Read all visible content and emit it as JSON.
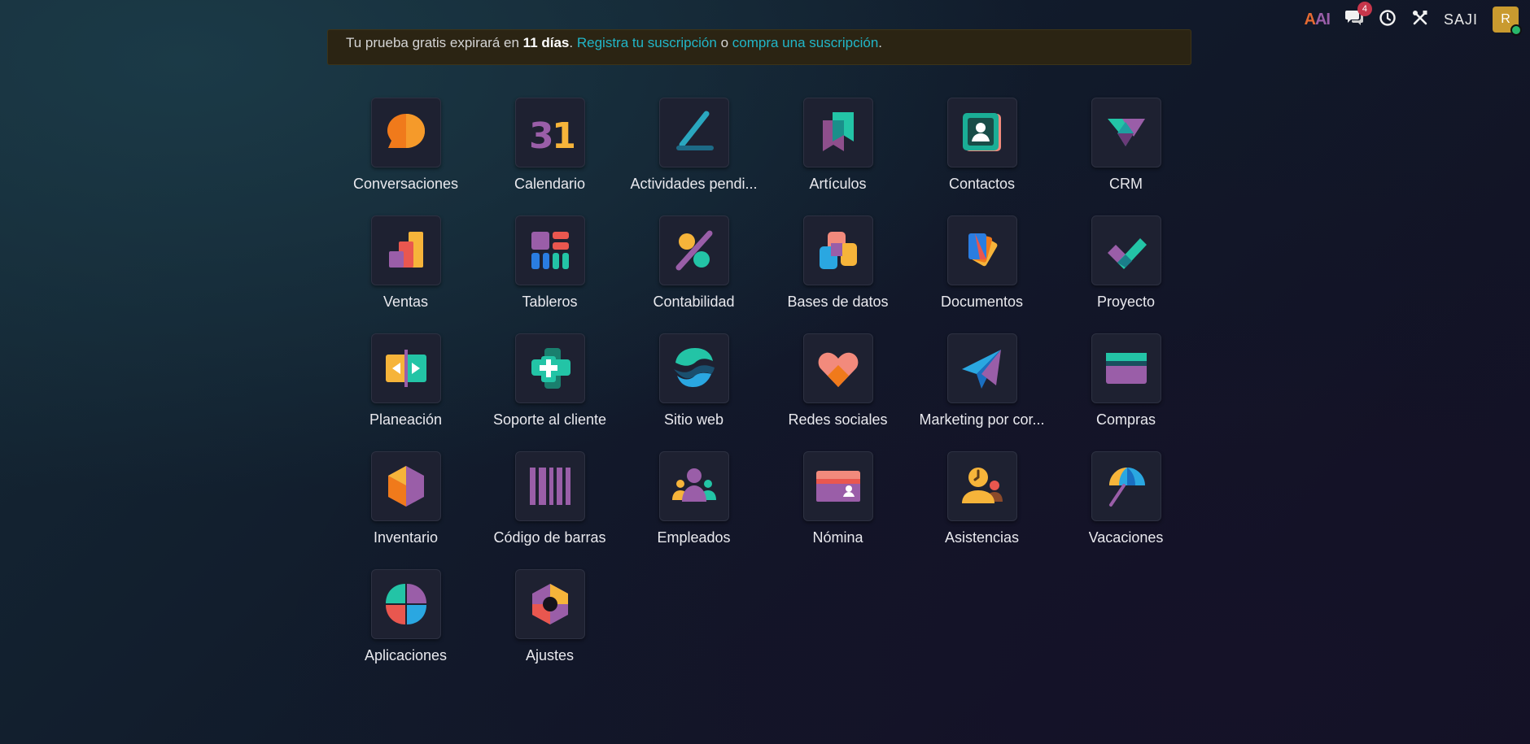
{
  "topbar": {
    "ai_label": "AI",
    "messages_icon": "chat-bubbles-icon",
    "messages_count": "4",
    "activity_icon": "clock-icon",
    "tools_icon": "tools-icon",
    "company": "SAJI",
    "avatar_initial": "R"
  },
  "banner": {
    "text_pre": "Tu prueba gratis expirará en",
    "days": "11 días",
    "sep1": ".",
    "link1": "Registra tu suscripción",
    "or": "o",
    "link2": "compra una suscripción",
    "sep2": "."
  },
  "apps": [
    {
      "label": "Conversaciones",
      "icon": "conversations-icon"
    },
    {
      "label": "Calendario",
      "icon": "calendar-icon"
    },
    {
      "label": "Actividades pendi...",
      "icon": "activities-icon"
    },
    {
      "label": "Artículos",
      "icon": "articles-icon"
    },
    {
      "label": "Contactos",
      "icon": "contacts-icon"
    },
    {
      "label": "CRM",
      "icon": "crm-icon"
    },
    {
      "label": "Ventas",
      "icon": "sales-icon"
    },
    {
      "label": "Tableros",
      "icon": "dashboards-icon"
    },
    {
      "label": "Contabilidad",
      "icon": "accounting-icon"
    },
    {
      "label": "Bases de datos",
      "icon": "databases-icon"
    },
    {
      "label": "Documentos",
      "icon": "documents-icon"
    },
    {
      "label": "Proyecto",
      "icon": "project-icon"
    },
    {
      "label": "Planeación",
      "icon": "planning-icon"
    },
    {
      "label": "Soporte al cliente",
      "icon": "helpdesk-icon"
    },
    {
      "label": "Sitio web",
      "icon": "website-icon"
    },
    {
      "label": "Redes sociales",
      "icon": "social-icon"
    },
    {
      "label": "Marketing por cor...",
      "icon": "email-marketing-icon"
    },
    {
      "label": "Compras",
      "icon": "purchase-icon"
    },
    {
      "label": "Inventario",
      "icon": "inventory-icon"
    },
    {
      "label": "Código de barras",
      "icon": "barcode-icon"
    },
    {
      "label": "Empleados",
      "icon": "employees-icon"
    },
    {
      "label": "Nómina",
      "icon": "payroll-icon"
    },
    {
      "label": "Asistencias",
      "icon": "attendances-icon"
    },
    {
      "label": "Vacaciones",
      "icon": "time-off-icon"
    },
    {
      "label": "Aplicaciones",
      "icon": "apps-icon"
    },
    {
      "label": "Ajustes",
      "icon": "settings-icon"
    }
  ]
}
